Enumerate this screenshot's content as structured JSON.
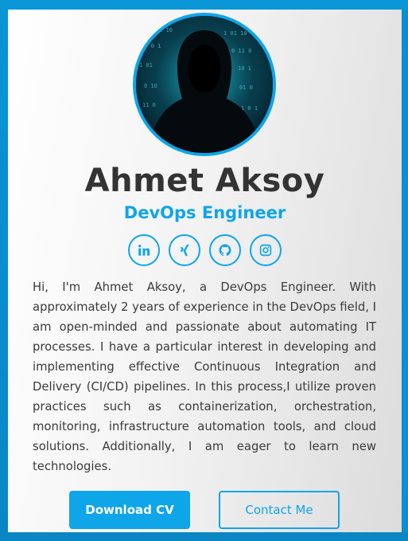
{
  "profile": {
    "name": "Ahmet Aksoy",
    "role": "DevOps Engineer",
    "avatar_alt": "hooded-figure-avatar",
    "bio": "Hi, I'm Ahmet Aksoy, a DevOps Engineer. With approximately 2 years of experience in the DevOps field, I am open-minded and passionate about automating IT processes. I have a particular interest in developing and implementing effective Continuous Integration and Delivery (CI/CD) pipelines. In this process,I utilize proven practices such as containerization, orchestration, monitoring, infrastructure automation tools, and cloud solutions. Additionally, I am eager to learn new technologies."
  },
  "socials": [
    {
      "icon": "linkedin-icon"
    },
    {
      "icon": "xing-icon"
    },
    {
      "icon": "github-icon"
    },
    {
      "icon": "instagram-icon"
    }
  ],
  "actions": {
    "download_cv_label": "Download CV",
    "contact_label": "Contact Me"
  },
  "colors": {
    "accent": "#0ea5e9",
    "frame": "#0a8fd0",
    "name_text": "#333333",
    "body_text": "#3a3a3a"
  }
}
